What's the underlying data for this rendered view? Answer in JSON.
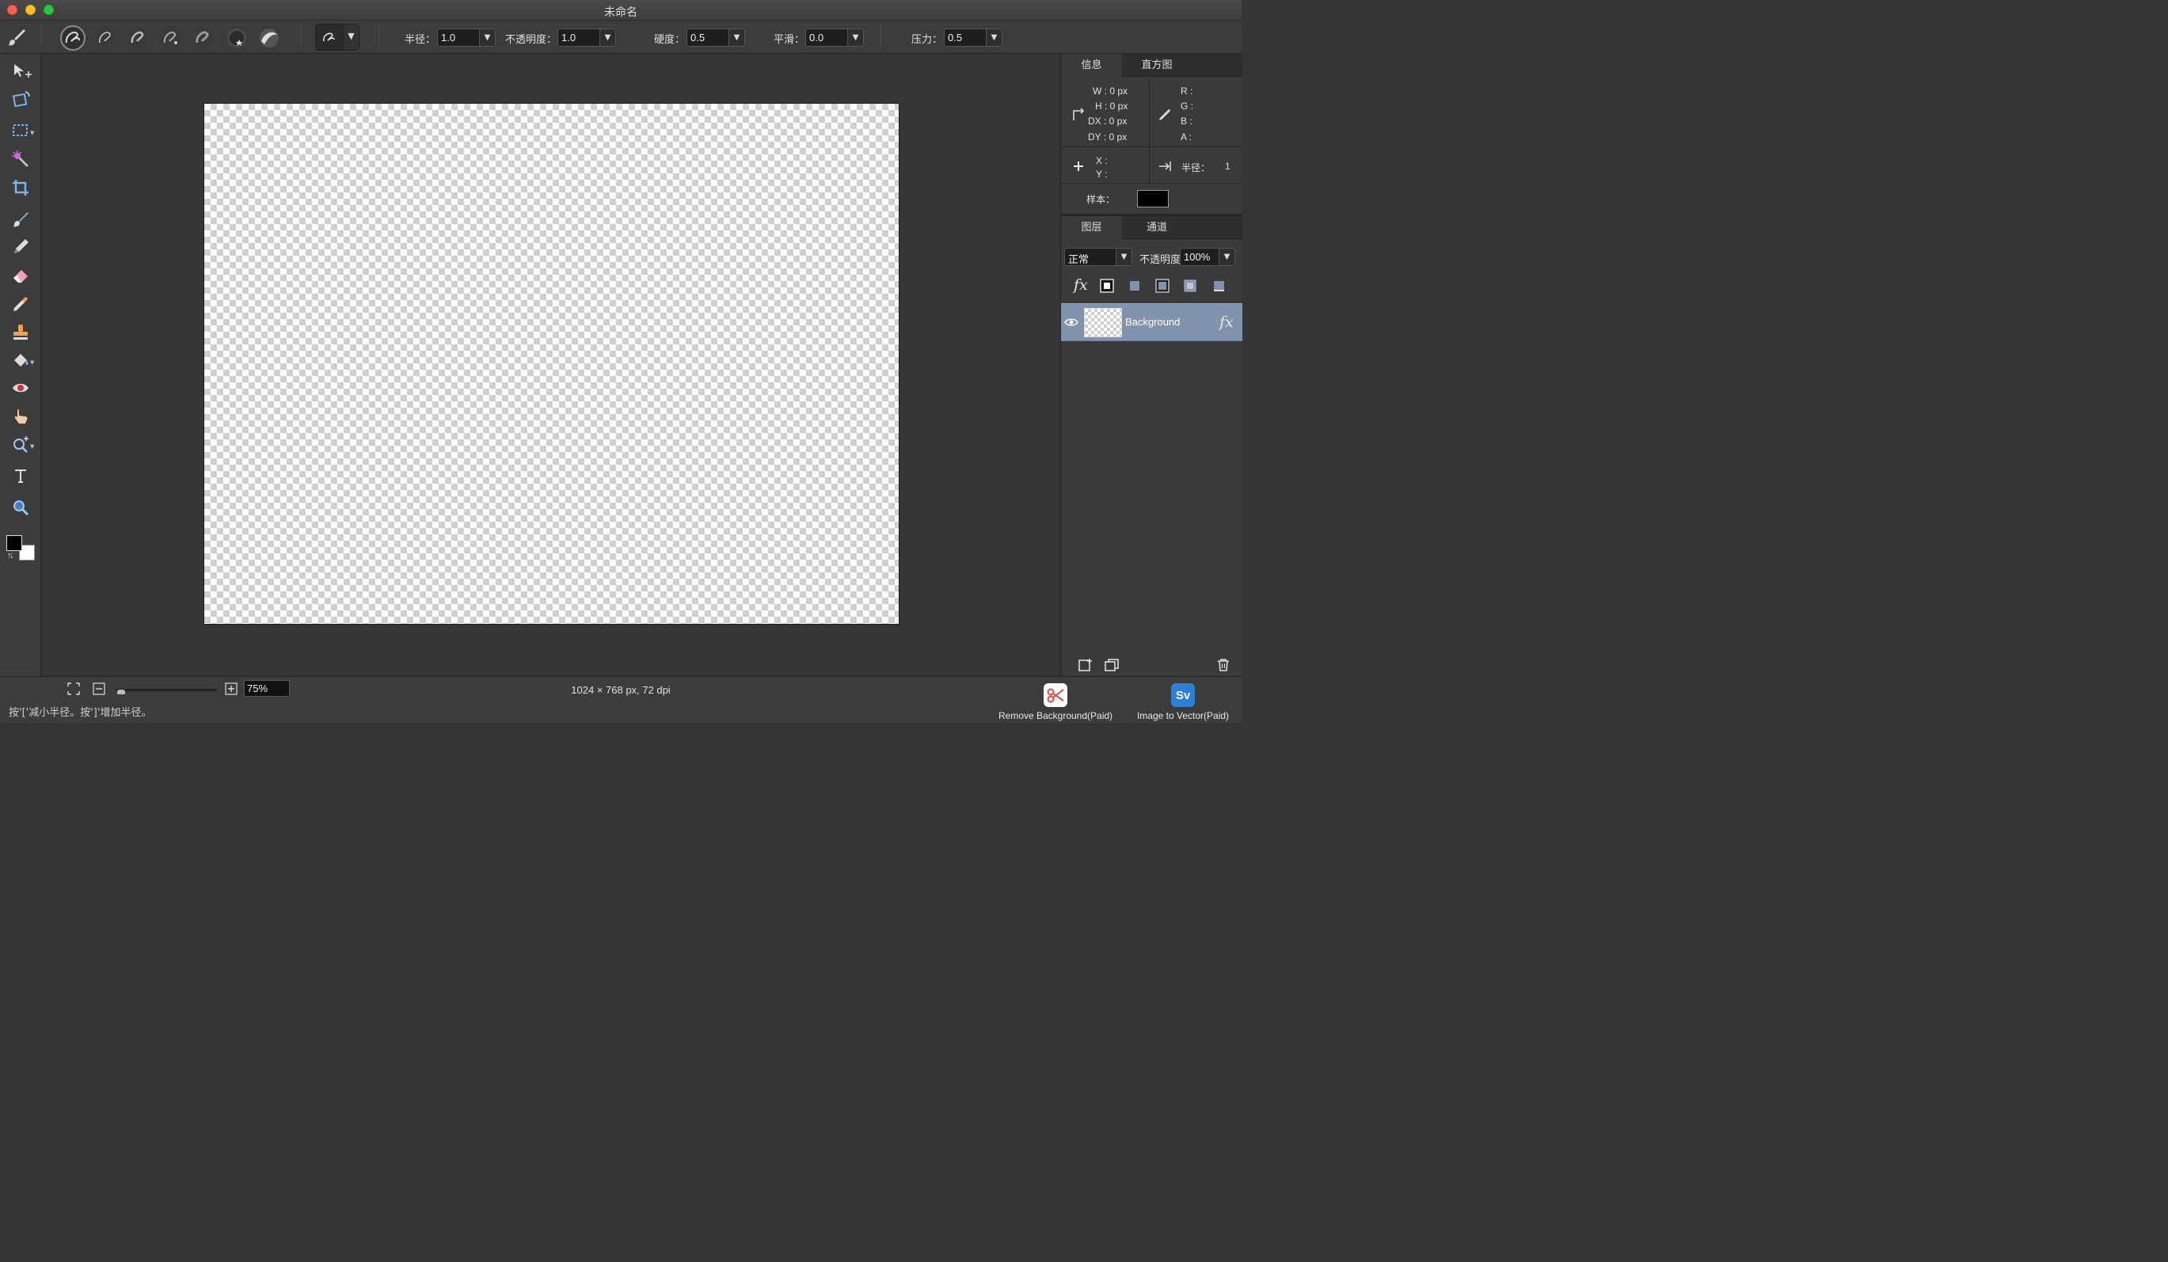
{
  "window": {
    "title": "未命名"
  },
  "options": {
    "radius_label": "半径：",
    "radius_value": "1.0",
    "opacity_label": "不透明度：",
    "opacity_value": "1.0",
    "hardness_label": "硬度：",
    "hardness_value": "0.5",
    "smooth_label": "平滑：",
    "smooth_value": "0.0",
    "pressure_label": "压力：",
    "pressure_value": "0.5"
  },
  "info_panel": {
    "tab_info": "信息",
    "tab_histogram": "直方图",
    "w": "W :  0 px",
    "h": "H :  0 px",
    "dx": "DX :  0 px",
    "dy": "DY :  0 px",
    "r": "R :",
    "g": "G :",
    "b": "B :",
    "a": "A :",
    "x": "X :",
    "y": "Y :",
    "radius_label": "半径：",
    "radius_value": "1",
    "sample_label": "样本："
  },
  "layers_panel": {
    "tab_layers": "图层",
    "tab_channels": "通道",
    "blend_mode": "正常",
    "opacity_label": "不透明度",
    "opacity_value": "100%",
    "layers": [
      {
        "name": "Background",
        "visible": true
      }
    ]
  },
  "status": {
    "zoom": "75%",
    "doc_info": "1024 × 768 px, 72 dpi",
    "hint": "按'['减小半径。按']'增加半径。"
  },
  "promos": {
    "remove_bg": "Remove Background(Paid)",
    "img_to_vector": "Image to Vector(Paid)"
  },
  "colors": {
    "foreground": "#000000",
    "background": "#ffffff",
    "layer_selected": "#8192ad"
  }
}
